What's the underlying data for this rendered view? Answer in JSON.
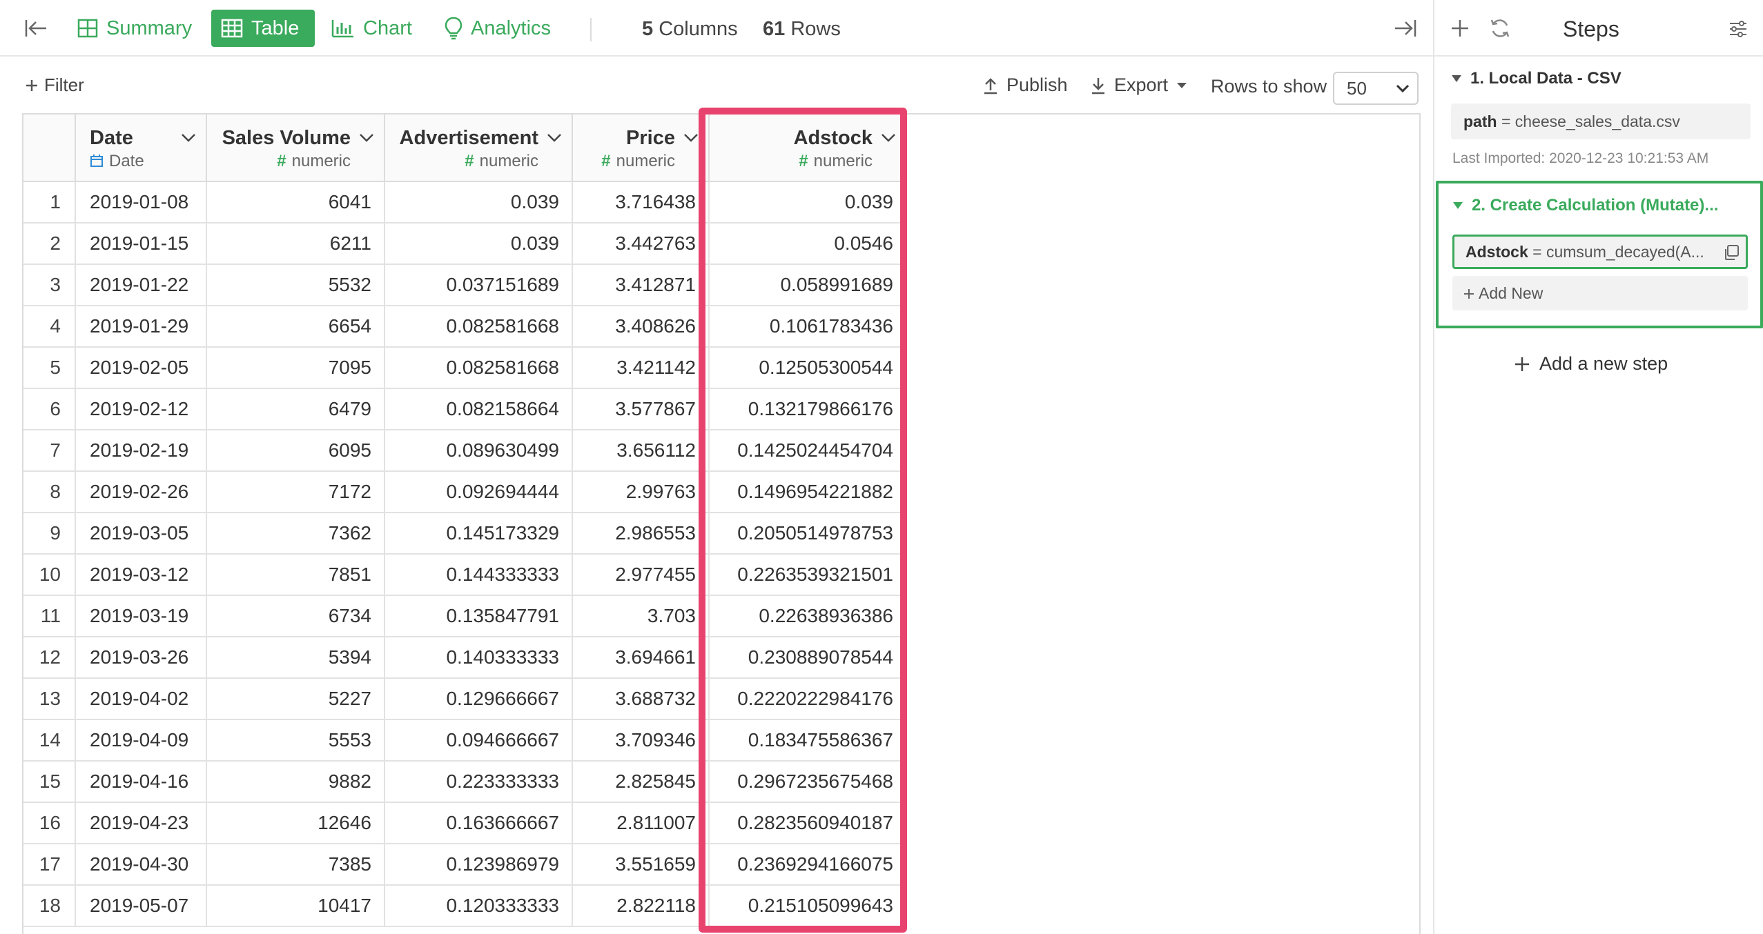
{
  "toolbar": {
    "tabs": [
      {
        "label": "Summary",
        "icon": "summary-grid-icon",
        "active": false
      },
      {
        "label": "Table",
        "icon": "table-icon",
        "active": true
      },
      {
        "label": "Chart",
        "icon": "bar-chart-icon",
        "active": false
      },
      {
        "label": "Analytics",
        "icon": "lightbulb-icon",
        "active": false
      }
    ],
    "columns_count": "5",
    "columns_label": "Columns",
    "rows_count": "61",
    "rows_label": "Rows",
    "accent_color": "#3aaa5c"
  },
  "subbar": {
    "filter_label": "Filter",
    "publish_label": "Publish",
    "export_label": "Export",
    "rows_to_show_label": "Rows to show",
    "rows_to_show_value": "50"
  },
  "table": {
    "columns": [
      {
        "name": "Date",
        "type": "Date",
        "type_icon": "calendar-icon"
      },
      {
        "name": "Sales Volume",
        "type": "numeric",
        "type_icon": "hash"
      },
      {
        "name": "Advertisement",
        "type": "numeric",
        "type_icon": "hash"
      },
      {
        "name": "Price",
        "type": "numeric",
        "type_icon": "hash"
      },
      {
        "name": "Adstock",
        "type": "numeric",
        "type_icon": "hash"
      }
    ],
    "hash_symbol": "#",
    "highlight_color": "#e8436e",
    "rows": [
      [
        "1",
        "2019-01-08",
        "6041",
        "0.039",
        "3.716438",
        "0.039"
      ],
      [
        "2",
        "2019-01-15",
        "6211",
        "0.039",
        "3.442763",
        "0.0546"
      ],
      [
        "3",
        "2019-01-22",
        "5532",
        "0.037151689",
        "3.412871",
        "0.058991689"
      ],
      [
        "4",
        "2019-01-29",
        "6654",
        "0.082581668",
        "3.408626",
        "0.1061783436"
      ],
      [
        "5",
        "2019-02-05",
        "7095",
        "0.082581668",
        "3.421142",
        "0.12505300544"
      ],
      [
        "6",
        "2019-02-12",
        "6479",
        "0.082158664",
        "3.577867",
        "0.132179866176"
      ],
      [
        "7",
        "2019-02-19",
        "6095",
        "0.089630499",
        "3.656112",
        "0.1425024454704"
      ],
      [
        "8",
        "2019-02-26",
        "7172",
        "0.092694444",
        "2.99763",
        "0.1496954221882"
      ],
      [
        "9",
        "2019-03-05",
        "7362",
        "0.145173329",
        "2.986553",
        "0.2050514978753"
      ],
      [
        "10",
        "2019-03-12",
        "7851",
        "0.144333333",
        "2.977455",
        "0.2263539321501"
      ],
      [
        "11",
        "2019-03-19",
        "6734",
        "0.135847791",
        "3.703",
        "0.22638936386"
      ],
      [
        "12",
        "2019-03-26",
        "5394",
        "0.140333333",
        "3.694661",
        "0.230889078544"
      ],
      [
        "13",
        "2019-04-02",
        "5227",
        "0.129666667",
        "3.688732",
        "0.2220222984176"
      ],
      [
        "14",
        "2019-04-09",
        "5553",
        "0.094666667",
        "3.709346",
        "0.183475586367"
      ],
      [
        "15",
        "2019-04-16",
        "9882",
        "0.223333333",
        "2.825845",
        "0.2967235675468"
      ],
      [
        "16",
        "2019-04-23",
        "12646",
        "0.163666667",
        "2.811007",
        "0.2823560940187"
      ],
      [
        "17",
        "2019-04-30",
        "7385",
        "0.123986979",
        "3.551659",
        "0.2369294166075"
      ],
      [
        "18",
        "2019-05-07",
        "10417",
        "0.120333333",
        "2.822118",
        "0.215105099643"
      ]
    ]
  },
  "steps": {
    "title": "Steps",
    "step1": {
      "title": "1. Local Data - CSV",
      "param_key": "path",
      "param_eq": " = ",
      "param_value": "cheese_sales_data.csv",
      "last_imported": "Last Imported: 2020-12-23 10:21:53 AM"
    },
    "step2": {
      "title": "2. Create Calculation (Mutate)...",
      "expr_key": "Adstock",
      "expr_eq": " = ",
      "expr_value": "cumsum_decayed(A...",
      "add_new_label": "Add New"
    },
    "add_step_label": "Add a new step"
  }
}
